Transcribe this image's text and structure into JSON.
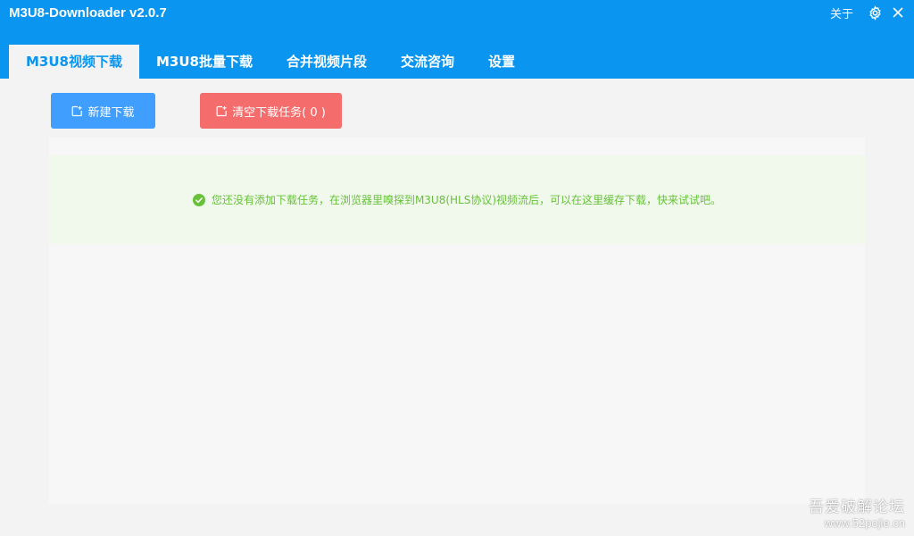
{
  "window": {
    "title": "M3U8-Downloader v2.0.7",
    "about_label": "关于",
    "settings_icon": "gear-icon",
    "close_icon": "close-icon"
  },
  "tabs": [
    {
      "label": "M3U8视频下载",
      "active": true
    },
    {
      "label": "M3U8批量下载",
      "active": false
    },
    {
      "label": "合并视频片段",
      "active": false
    },
    {
      "label": "交流咨询",
      "active": false
    },
    {
      "label": "设置",
      "active": false
    }
  ],
  "toolbar": {
    "new_download_label": "新建下载",
    "clear_tasks_label": "清空下载任务( 0 )"
  },
  "notice": {
    "icon": "check-circle-icon",
    "text": "您还没有添加下载任务，在浏览器里嗅探到M3U8(HLS协议)视频流后，可以在这里缓存下载，快来试试吧。"
  },
  "watermark": {
    "title": "吾爱破解论坛",
    "url": "www.52pojie.cn"
  },
  "colors": {
    "primary": "#0a96f0",
    "button_primary": "#409eff",
    "button_danger": "#f56c6c",
    "success": "#67c23a",
    "success_bg": "#f0f9eb"
  }
}
